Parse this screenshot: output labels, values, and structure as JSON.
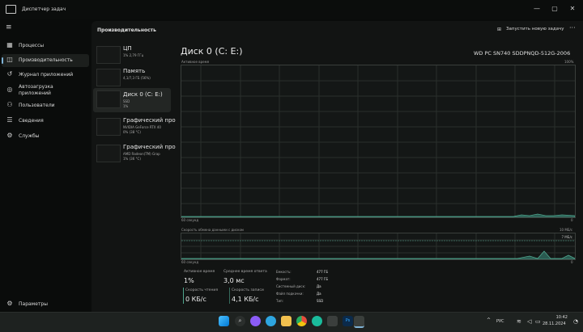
{
  "window": {
    "title": "Диспетчер задач",
    "controls": [
      "minimize-icon",
      "maximize-icon",
      "close-icon"
    ]
  },
  "sidebar": {
    "items": [
      {
        "label": "Процессы",
        "icon": "processes-icon"
      },
      {
        "label": "Производительность",
        "icon": "performance-icon",
        "active": true
      },
      {
        "label": "Журнал приложений",
        "icon": "history-icon"
      },
      {
        "label": "Автозагрузка приложений",
        "icon": "startup-icon"
      },
      {
        "label": "Пользователи",
        "icon": "users-icon"
      },
      {
        "label": "Сведения",
        "icon": "details-icon"
      },
      {
        "label": "Службы",
        "icon": "services-icon"
      }
    ],
    "settings_label": "Параметры"
  },
  "header": {
    "title": "Производительность",
    "run_task_label": "Запустить новую задачу",
    "more_label": "···"
  },
  "devices": [
    {
      "name": "ЦП",
      "sub1": "1% 2,79 ГГц",
      "sub2": ""
    },
    {
      "name": "Память",
      "sub1": "4,1/7,3 ГБ (56%)",
      "sub2": ""
    },
    {
      "name": "Диск 0 (C: E:)",
      "sub1": "SSD",
      "sub2": "1%",
      "active": true
    },
    {
      "name": "Графический про",
      "sub1": "NVIDIA GeForce RTX 40",
      "sub2": "0% (38 °C)"
    },
    {
      "name": "Графический про",
      "sub1": "AMD Radeon(TM) Grap",
      "sub2": "1% (36 °C)"
    }
  ],
  "detail": {
    "title": "Диск 0 (C: E:)",
    "model": "WD PC SN740 SDDPNQD-512G-2006",
    "graph1": {
      "label": "Активное время",
      "max": "100%",
      "time_label": "60 секунд",
      "min": "0"
    },
    "graph2": {
      "label": "Скорость обмена данными с диском",
      "max_top": "10 МБ/с",
      "max_inner": "7 МБ/с",
      "time_label": "60 секунд",
      "min": "0"
    },
    "stats": {
      "active_time_label": "Активное время",
      "active_time_value": "1%",
      "response_label": "Среднее время ответа",
      "response_value": "3,0 мс",
      "read_label": "Скорость чтения",
      "read_value": "0 КБ/с",
      "write_label": "Скорость записи",
      "write_value": "4,1 КБ/с"
    },
    "props": [
      {
        "k": "Емкость:",
        "v": "477 ГБ"
      },
      {
        "k": "Формат:",
        "v": "477 ГБ"
      },
      {
        "k": "Системный диск:",
        "v": "Да"
      },
      {
        "k": "Файл подкачки:",
        "v": "Да"
      },
      {
        "k": "Тип:",
        "v": "SSD"
      }
    ]
  },
  "taskbar": {
    "apps": [
      "windows-icon",
      "search-icon",
      "edge-icon",
      "telegram-icon",
      "explorer-icon",
      "chrome-icon",
      "store-icon",
      "xbox-icon",
      "photoshop-icon",
      "taskmanager-icon"
    ],
    "lang": "РУС",
    "time": "10:42",
    "date": "28.11.2024"
  },
  "colors": {
    "accent": "#7fb3d6",
    "disk_graph": "#4fa58d"
  }
}
